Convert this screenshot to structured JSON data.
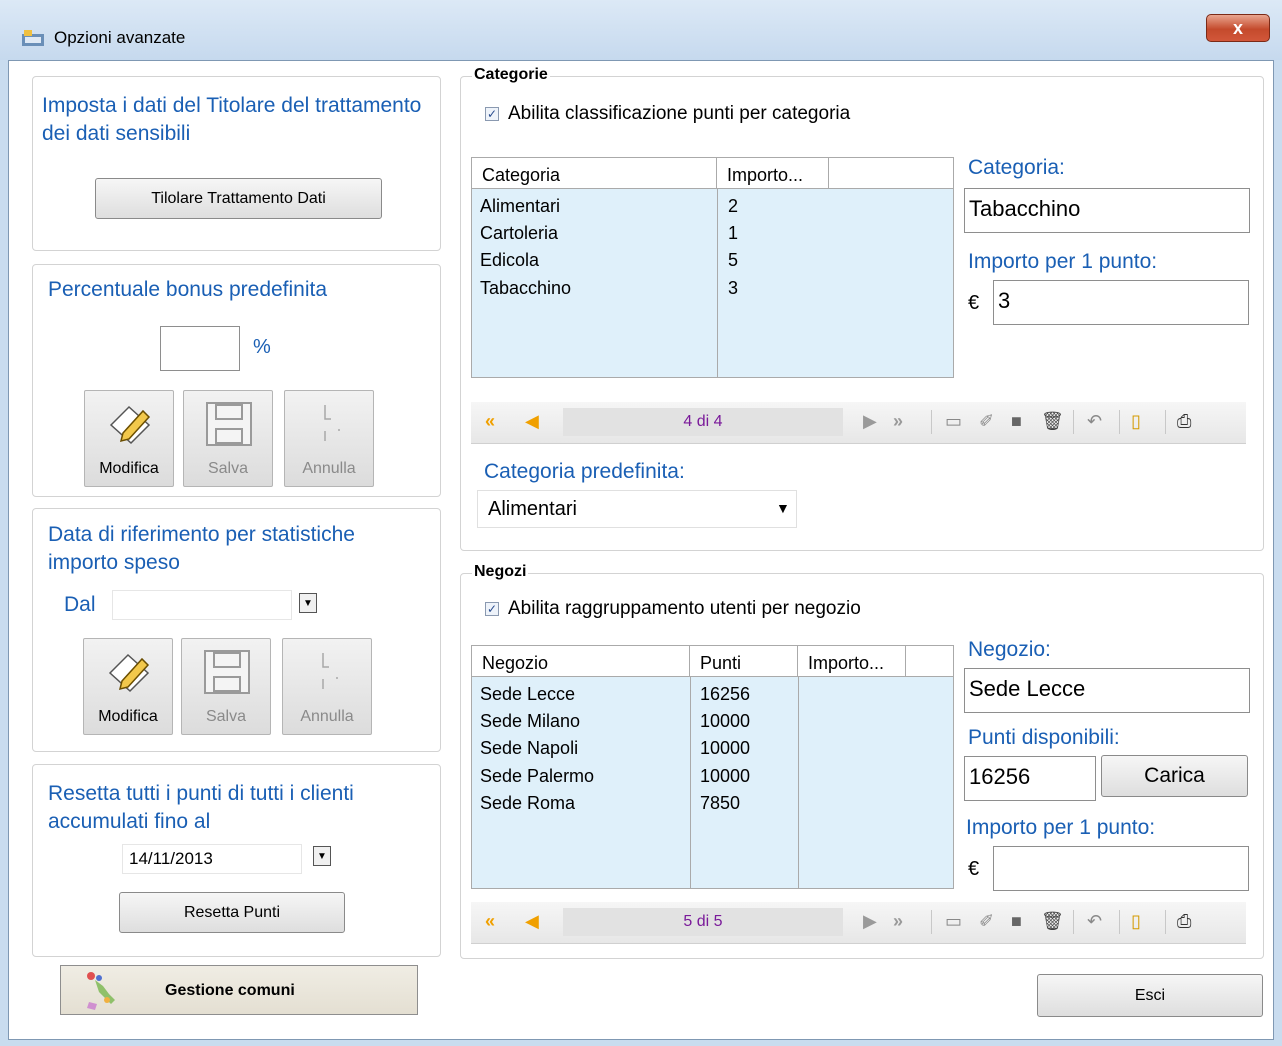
{
  "window": {
    "title": "Opzioni avanzate",
    "close_label": "x"
  },
  "titolare": {
    "heading": "Imposta i dati del Titolare del trattamento dei dati sensibili",
    "button": "Tilolare Trattamento Dati"
  },
  "bonus": {
    "heading": "Percentuale bonus predefinita",
    "value": "",
    "unit": "%",
    "buttons": [
      "Modifica",
      "Salva",
      "Annulla"
    ]
  },
  "data_riferimento": {
    "heading": "Data di riferimento per statistiche importo speso",
    "dal_label": "Dal",
    "value": "",
    "buttons": [
      "Modifica",
      "Salva",
      "Annulla"
    ]
  },
  "reset": {
    "heading": "Resetta tutti i punti di tutti i clienti accumulati fino al",
    "date": "14/11/2013",
    "button": "Resetta Punti"
  },
  "gestione_comuni": "Gestione comuni",
  "categorie": {
    "group_title": "Categorie",
    "checkbox_label": "Abilita classificazione punti per categoria",
    "checked": true,
    "columns": [
      "Categoria",
      "Importo..."
    ],
    "rows": [
      [
        "Alimentari",
        "2"
      ],
      [
        "Cartoleria",
        "1"
      ],
      [
        "Edicola",
        "5"
      ],
      [
        "Tabacchino",
        "3"
      ]
    ],
    "nav_position": "4 di 4",
    "field_categoria_label": "Categoria:",
    "field_categoria_value": "Tabacchino",
    "field_importo_label": "Importo per 1 punto:",
    "currency": "€",
    "field_importo_value": "3",
    "predefinita_label": "Categoria predefinita:",
    "predefinita_value": "Alimentari"
  },
  "negozi": {
    "group_title": "Negozi",
    "checkbox_label": "Abilita raggruppamento utenti per negozio",
    "checked": true,
    "columns": [
      "Negozio",
      "Punti",
      "Importo..."
    ],
    "rows": [
      [
        "Sede Lecce",
        "16256",
        ""
      ],
      [
        "Sede Milano",
        "10000",
        ""
      ],
      [
        "Sede Napoli",
        "10000",
        ""
      ],
      [
        "Sede Palermo",
        "10000",
        ""
      ],
      [
        "Sede Roma",
        "7850",
        ""
      ]
    ],
    "nav_position": "5 di 5",
    "field_negozio_label": "Negozio:",
    "field_negozio_value": "Sede Lecce",
    "field_punti_label": "Punti disponibili:",
    "field_punti_value": "16256",
    "carica_button": "Carica",
    "field_importo_label": "Importo per 1 punto:",
    "currency": "€",
    "field_importo_value": ""
  },
  "esci_button": "Esci",
  "colors": {
    "accent_blue": "#1a5fb4",
    "grid_bg": "#dff0fa",
    "nav_position_text": "#7a1a9a",
    "nav_arrow_orange": "#f0a000"
  }
}
